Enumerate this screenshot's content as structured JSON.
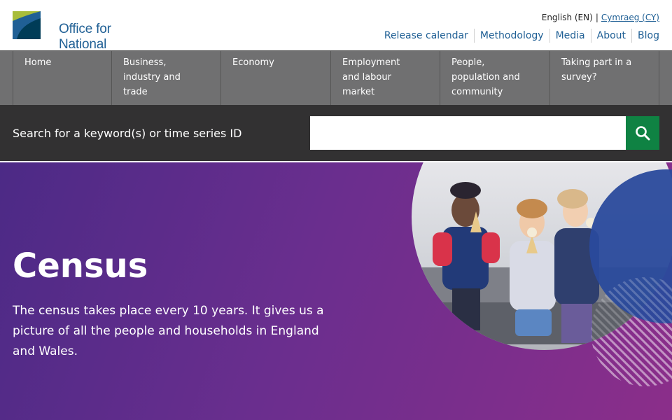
{
  "header": {
    "logo": {
      "line1": "Office for",
      "line2": "National Statistics"
    },
    "language": {
      "current": "English (EN)",
      "separator": "|",
      "alternate": "Cymraeg (CY)"
    },
    "links": [
      "Release calendar",
      "Methodology",
      "Media",
      "About",
      "Blog"
    ]
  },
  "nav": {
    "items": [
      {
        "label": "Home"
      },
      {
        "label": "Business, industry and trade"
      },
      {
        "label": "Economy"
      },
      {
        "label": "Employment and labour market"
      },
      {
        "label": "People, population and community"
      },
      {
        "label": "Taking part in a survey?"
      }
    ]
  },
  "search": {
    "label": "Search for a keyword(s) or time series ID",
    "value": "",
    "icon": "search-icon"
  },
  "hero": {
    "title": "Census",
    "description": "The census takes place every 10 years. It gives us a picture of all the people and households in England and Wales.",
    "image": "children-eating-ice-cream-photo"
  },
  "colors": {
    "brand_blue": "#206095",
    "brand_green": "#a8bd3a",
    "nav_grey": "#707071",
    "search_bar": "#323132",
    "search_button": "#0f8243",
    "hero_purple": "#6a2e8e"
  }
}
